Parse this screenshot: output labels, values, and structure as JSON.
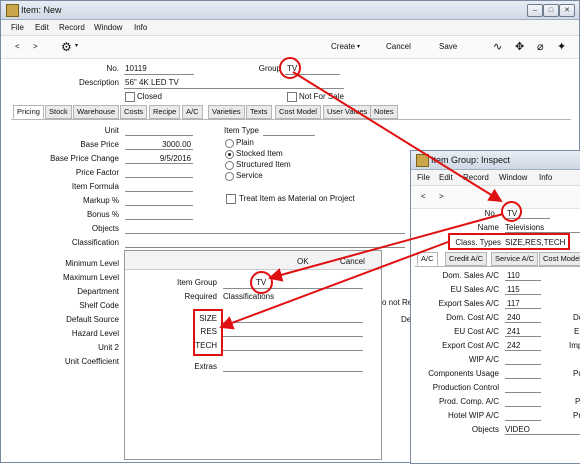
{
  "item_window": {
    "title": "Item: New",
    "menu": [
      "File",
      "Edit",
      "Record",
      "Window",
      "Info"
    ],
    "toolbar": {
      "back": "<",
      "forward": ">",
      "create": "Create",
      "cancel": "Cancel",
      "save": "Save",
      "ops_icon": "gear-icon"
    },
    "fields": {
      "no_label": "No.",
      "no_value": "10119",
      "group_label": "Group",
      "group_value": "TV",
      "description_label": "Description",
      "description_value": "56\" 4K LED TV",
      "closed_label": "Closed",
      "not_for_sale_label": "Not For Sale"
    },
    "tabs": [
      "Pricing",
      "Stock",
      "Warehouse",
      "Costs",
      "Recipe",
      "A/C",
      "Varieties",
      "Texts",
      "Cost Model",
      "User Values",
      "Notes"
    ],
    "pricing": {
      "unit_label": "Unit",
      "base_price_label": "Base Price",
      "base_price_value": "3000.00",
      "base_price_change_label": "Base Price Change",
      "base_price_change_value": "9/5/2016",
      "price_factor_label": "Price Factor",
      "item_formula_label": "Item Formula",
      "markup_label": "Markup %",
      "bonus_label": "Bonus %",
      "objects_label": "Objects",
      "classification_label": "Classification",
      "item_type_label": "Item Type",
      "item_types": [
        "Plain",
        "Stocked Item",
        "Structured Item",
        "Service"
      ],
      "treat_material_label": "Treat Item as Material on Project"
    },
    "lower_labels": [
      "Minimum Level",
      "Maximum Level",
      "Department",
      "Shelf Code",
      "Default Source",
      "Hazard Level",
      "Unit 2",
      "Unit Coefficient"
    ],
    "partial_right": [
      "o not Re",
      "De"
    ]
  },
  "classification_dialog": {
    "ok": "OK",
    "cancel": "Cancel",
    "item_group_label": "Item Group",
    "item_group_value": "TV",
    "required_label": "Required",
    "required_value": "Classifications",
    "classes": [
      "SIZE",
      "RES",
      "TECH"
    ],
    "extras_label": "Extras"
  },
  "group_window": {
    "title": "Item Group: Inspect",
    "menu": [
      "File",
      "Edit",
      "Record",
      "Window",
      "Info"
    ],
    "toolbar": {
      "back": "<",
      "forward": ">"
    },
    "code_label": "No.",
    "code_value": "TV",
    "name_label": "Name",
    "name_value": "Televisions",
    "class_types_label": "Class. Types",
    "class_types_value": "SIZE,RES,TECH",
    "tabs": [
      "A/C",
      "Credit A/C",
      "Service A/C",
      "Cost Model"
    ],
    "accounts": [
      {
        "label": "Dom. Sales A/C",
        "value": "110"
      },
      {
        "label": "EU Sales A/C",
        "value": "115"
      },
      {
        "label": "Export Sales A/C",
        "value": "117"
      },
      {
        "label": "Dom. Cost A/C",
        "value": "240"
      },
      {
        "label": "EU Cost A/C",
        "value": "241"
      },
      {
        "label": "Export Cost A/C",
        "value": "242"
      },
      {
        "label": "WIP A/C",
        "value": ""
      },
      {
        "label": "Components Usage",
        "value": ""
      },
      {
        "label": "Production Control",
        "value": ""
      },
      {
        "label": "Prod. Comp. A/C",
        "value": ""
      },
      {
        "label": "Hotel WIP A/C",
        "value": ""
      },
      {
        "label": "Objects",
        "value": "VIDEO"
      }
    ],
    "partial_right": [
      "Do",
      "E",
      "Imp",
      "Pu",
      "P",
      "Pr"
    ]
  },
  "colors": {
    "annotation": "#e01010",
    "titlebar": "#cfd8e4"
  }
}
